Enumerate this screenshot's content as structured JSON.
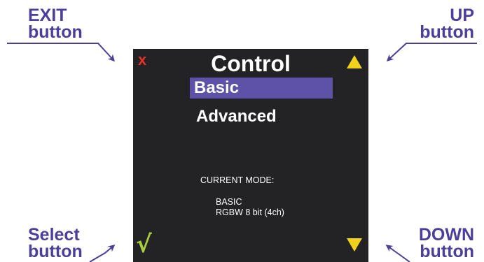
{
  "callouts": {
    "exit": {
      "line1": "EXIT",
      "line2": "button"
    },
    "up": {
      "line1": "UP",
      "line2": "button"
    },
    "select": {
      "line1": "Select",
      "line2": "button"
    },
    "down": {
      "line1": "DOWN",
      "line2": "button"
    }
  },
  "screen": {
    "title": "Control",
    "menu": [
      {
        "label": "Basic",
        "selected": true
      },
      {
        "label": "Advanced",
        "selected": false
      }
    ],
    "current_mode": {
      "heading": "CURRENT MODE:",
      "line1": "BASIC",
      "line2": "RGBW 8 bit (4ch)"
    },
    "icons": {
      "exit": {
        "name": "close-icon",
        "glyph": "x",
        "color": "#e8302a"
      },
      "up": {
        "name": "up-arrow-icon",
        "color": "#f0d21c"
      },
      "down": {
        "name": "down-arrow-icon",
        "color": "#f0d21c"
      },
      "select": {
        "name": "checkmark-icon",
        "glyph": "√",
        "color": "#a8cf3c"
      }
    }
  },
  "colors": {
    "callout_text": "#4b3f99",
    "screen_bg": "#232325",
    "highlight": "#5d52a8"
  }
}
